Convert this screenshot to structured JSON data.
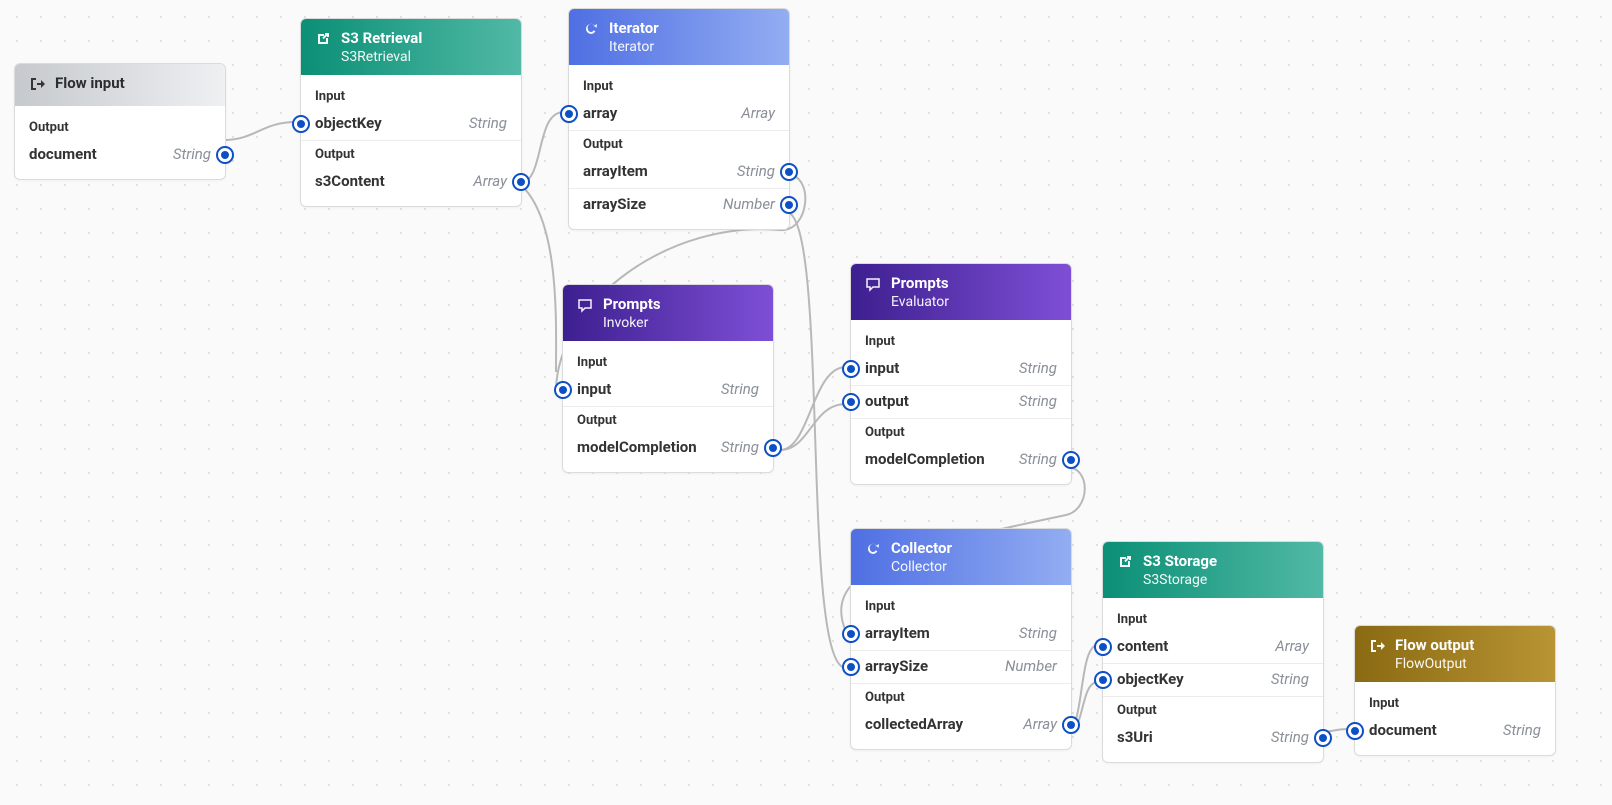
{
  "labels": {
    "input": "Input",
    "output": "Output"
  },
  "nodes": {
    "flowInput": {
      "title": "Flow input",
      "outputs": [
        {
          "name": "document",
          "type": "String"
        }
      ]
    },
    "s3Retrieval": {
      "title": "S3 Retrieval",
      "subtitle": "S3Retrieval",
      "inputs": [
        {
          "name": "objectKey",
          "type": "String"
        }
      ],
      "outputs": [
        {
          "name": "s3Content",
          "type": "Array"
        }
      ]
    },
    "iterator": {
      "title": "Iterator",
      "subtitle": "Iterator",
      "inputs": [
        {
          "name": "array",
          "type": "Array"
        }
      ],
      "outputs": [
        {
          "name": "arrayItem",
          "type": "String"
        },
        {
          "name": "arraySize",
          "type": "Number"
        }
      ]
    },
    "promptsInvoker": {
      "title": "Prompts",
      "subtitle": "Invoker",
      "inputs": [
        {
          "name": "input",
          "type": "String"
        }
      ],
      "outputs": [
        {
          "name": "modelCompletion",
          "type": "String"
        }
      ]
    },
    "promptsEvaluator": {
      "title": "Prompts",
      "subtitle": "Evaluator",
      "inputs": [
        {
          "name": "input",
          "type": "String"
        },
        {
          "name": "output",
          "type": "String"
        }
      ],
      "outputs": [
        {
          "name": "modelCompletion",
          "type": "String"
        }
      ]
    },
    "collector": {
      "title": "Collector",
      "subtitle": "Collector",
      "inputs": [
        {
          "name": "arrayItem",
          "type": "String"
        },
        {
          "name": "arraySize",
          "type": "Number"
        }
      ],
      "outputs": [
        {
          "name": "collectedArray",
          "type": "Array"
        }
      ]
    },
    "s3Storage": {
      "title": "S3 Storage",
      "subtitle": "S3Storage",
      "inputs": [
        {
          "name": "content",
          "type": "Array"
        },
        {
          "name": "objectKey",
          "type": "String"
        }
      ],
      "outputs": [
        {
          "name": "s3Uri",
          "type": "String"
        }
      ]
    },
    "flowOutput": {
      "title": "Flow output",
      "subtitle": "FlowOutput",
      "inputs": [
        {
          "name": "document",
          "type": "String"
        }
      ]
    }
  }
}
